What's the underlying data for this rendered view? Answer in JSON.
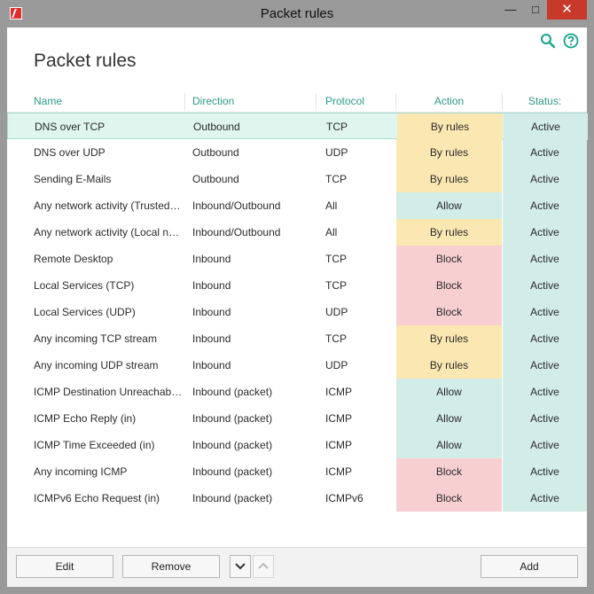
{
  "window": {
    "title": "Packet rules",
    "minimize_glyph": "—",
    "maximize_glyph": "□",
    "close_glyph": "✕",
    "close_color": "#c7392b"
  },
  "toolbar": {
    "search_icon": "search-icon",
    "help_icon": "help-icon",
    "icon_color": "#14a38b"
  },
  "page": {
    "title": "Packet rules"
  },
  "table": {
    "columns": {
      "name": "Name",
      "direction": "Direction",
      "protocol": "Protocol",
      "action": "Action",
      "status": "Status:"
    },
    "action_colors": {
      "By rules": "#fbe7b1",
      "Allow": "#d2ece8",
      "Block": "#f8cfd1"
    },
    "status_color": "#d2ece8",
    "selected_row": 0,
    "rows": [
      {
        "name": "DNS over TCP",
        "direction": "Outbound",
        "protocol": "TCP",
        "action": "By rules",
        "status": "Active"
      },
      {
        "name": "DNS over UDP",
        "direction": "Outbound",
        "protocol": "UDP",
        "action": "By rules",
        "status": "Active"
      },
      {
        "name": "Sending E-Mails",
        "direction": "Outbound",
        "protocol": "TCP",
        "action": "By rules",
        "status": "Active"
      },
      {
        "name": "Any network activity (Trusted…",
        "direction": "Inbound/Outbound",
        "protocol": "All",
        "action": "Allow",
        "status": "Active"
      },
      {
        "name": "Any network activity (Local ne…",
        "direction": "Inbound/Outbound",
        "protocol": "All",
        "action": "By rules",
        "status": "Active"
      },
      {
        "name": "Remote Desktop",
        "direction": "Inbound",
        "protocol": "TCP",
        "action": "Block",
        "status": "Active"
      },
      {
        "name": "Local Services (TCP)",
        "direction": "Inbound",
        "protocol": "TCP",
        "action": "Block",
        "status": "Active"
      },
      {
        "name": "Local Services (UDP)",
        "direction": "Inbound",
        "protocol": "UDP",
        "action": "Block",
        "status": "Active"
      },
      {
        "name": "Any incoming TCP stream",
        "direction": "Inbound",
        "protocol": "TCP",
        "action": "By rules",
        "status": "Active"
      },
      {
        "name": "Any incoming UDP stream",
        "direction": "Inbound",
        "protocol": "UDP",
        "action": "By rules",
        "status": "Active"
      },
      {
        "name": "ICMP Destination Unreachabl…",
        "direction": "Inbound (packet)",
        "protocol": "ICMP",
        "action": "Allow",
        "status": "Active"
      },
      {
        "name": "ICMP Echo Reply (in)",
        "direction": "Inbound (packet)",
        "protocol": "ICMP",
        "action": "Allow",
        "status": "Active"
      },
      {
        "name": "ICMP Time Exceeded (in)",
        "direction": "Inbound (packet)",
        "protocol": "ICMP",
        "action": "Allow",
        "status": "Active"
      },
      {
        "name": "Any incoming ICMP",
        "direction": "Inbound (packet)",
        "protocol": "ICMP",
        "action": "Block",
        "status": "Active"
      },
      {
        "name": "ICMPv6 Echo Request (in)",
        "direction": "Inbound (packet)",
        "protocol": "ICMPv6",
        "action": "Block",
        "status": "Active"
      }
    ]
  },
  "footer": {
    "edit_label": "Edit",
    "remove_label": "Remove",
    "move_down_icon": "chevron-down-icon",
    "move_up_icon": "chevron-up-icon",
    "add_label": "Add"
  }
}
